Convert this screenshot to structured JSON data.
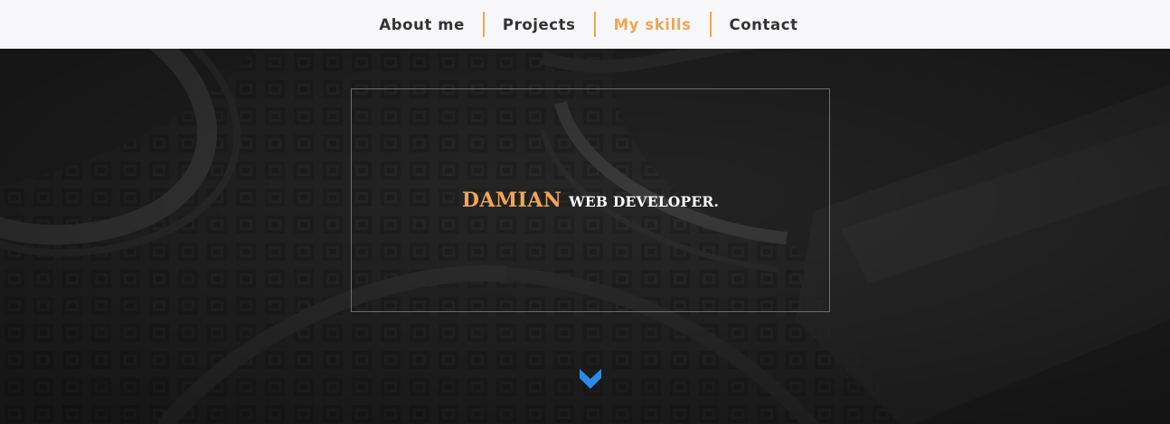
{
  "nav": {
    "items": [
      {
        "label": "About me"
      },
      {
        "label": "Projects"
      },
      {
        "label": "My skills"
      },
      {
        "label": "Contact"
      }
    ],
    "active_item": "My skills"
  },
  "hero": {
    "name": "DAMIAN",
    "role": "WEB DEVELOPER.",
    "scroll_icon": "chevron-down-icon"
  },
  "colors": {
    "accent": "#f2a553",
    "nav_background": "#f8f8fa",
    "nav_text": "#333333",
    "hero_background": "#232323",
    "hero_text": "#ffffff",
    "scroll_icon": "#2a8ce6"
  }
}
